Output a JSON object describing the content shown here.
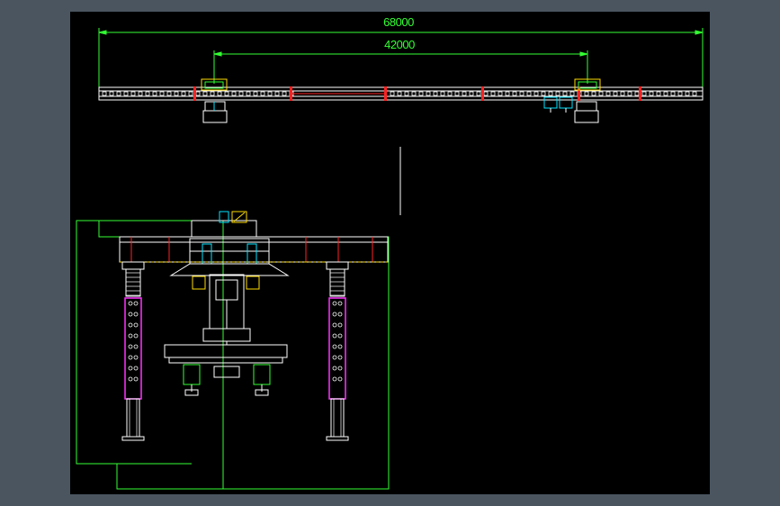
{
  "window": {
    "background_color": "#4a5560",
    "sheet_color": "#000000"
  },
  "drawing": {
    "top_view": {
      "dim_overall": "68000",
      "dim_span": "42000"
    },
    "colors": {
      "structure": "#ffffff",
      "dimension": "#33ff33",
      "joint": "#ff2222",
      "column": "#ff33ff",
      "detail_yellow": "#ffdd00",
      "detail_cyan": "#00e5ff"
    }
  }
}
